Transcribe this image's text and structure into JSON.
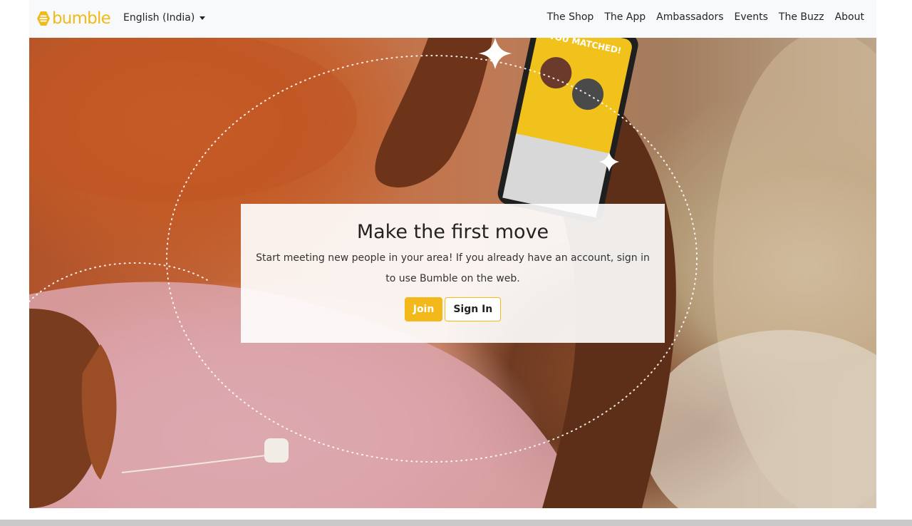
{
  "brand": {
    "logo_text": "bumble",
    "color": "#f0bb19"
  },
  "nav": {
    "language": "English (India)",
    "links": [
      "The Shop",
      "The App",
      "Ambassadors",
      "Events",
      "The Buzz",
      "About"
    ]
  },
  "hero": {
    "title": "Make the first move",
    "subtitle": "Start meeting new people in your area! If you already have an account, sign in to use Bumble on the web.",
    "join_label": "Join",
    "signin_label": "Sign In",
    "phone_text": "YOU MATCHED!"
  },
  "colors": {
    "accent": "#f3b91b",
    "navbar_bg": "#f8f9fa"
  },
  "icons": {
    "logo": "bumble-hive-icon",
    "language_toggle": "caret-down-icon",
    "sparkle": "sparkle-icon"
  }
}
